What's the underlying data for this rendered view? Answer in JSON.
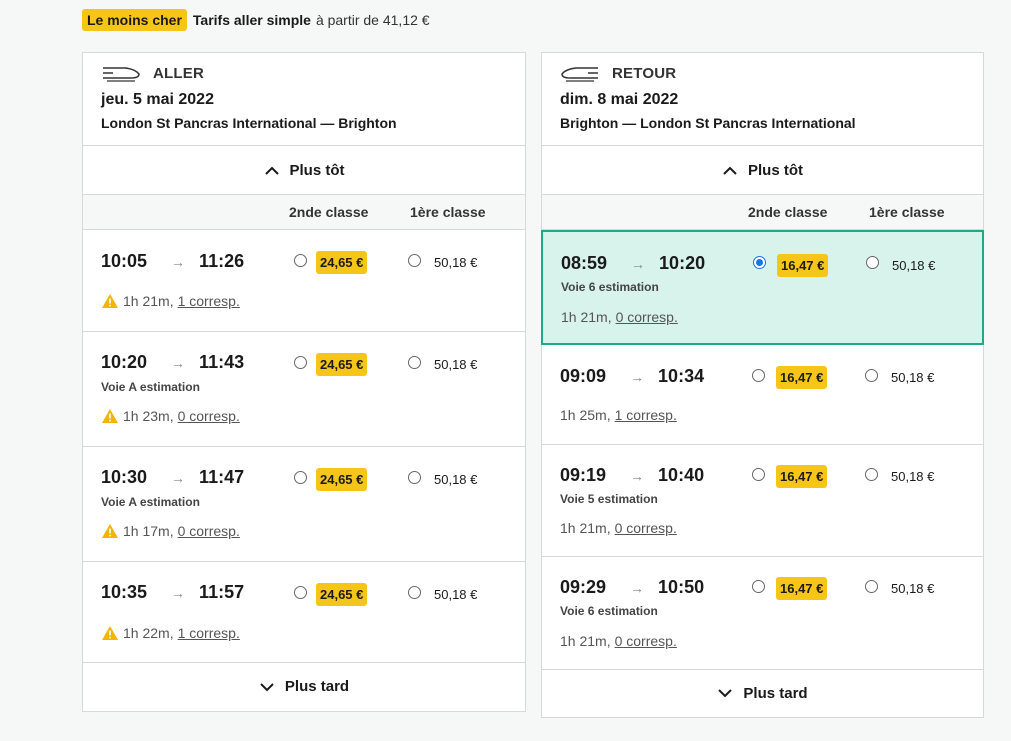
{
  "top": {
    "badge": "Le moins cher",
    "title": "Tarifs aller simple",
    "subtitle": "à partir de 41,12 €"
  },
  "aller": {
    "direction": "ALLER",
    "date": "jeu. 5 mai 2022",
    "route": "London St Pancras International — Brighton",
    "earlier": "Plus tôt",
    "later": "Plus tard",
    "class2": "2nde classe",
    "class1": "1ère classe",
    "rows": [
      {
        "dep": "10:05",
        "arr": "11:26",
        "voie": "",
        "duration": "1h 21m,",
        "corresp": "1 corresp.",
        "price2": "24,65 €",
        "price1": "50,18 €"
      },
      {
        "dep": "10:20",
        "arr": "11:43",
        "voie": "Voie A estimation",
        "duration": "1h 23m,",
        "corresp": "0 corresp.",
        "price2": "24,65 €",
        "price1": "50,18 €"
      },
      {
        "dep": "10:30",
        "arr": "11:47",
        "voie": "Voie A estimation",
        "duration": "1h 17m,",
        "corresp": "0 corresp.",
        "price2": "24,65 €",
        "price1": "50,18 €"
      },
      {
        "dep": "10:35",
        "arr": "11:57",
        "voie": "",
        "duration": "1h 22m,",
        "corresp": "1 corresp.",
        "price2": "24,65 €",
        "price1": "50,18 €"
      }
    ]
  },
  "retour": {
    "direction": "RETOUR",
    "date": "dim. 8 mai 2022",
    "route": "Brighton — London St Pancras International",
    "earlier": "Plus tôt",
    "later": "Plus tard",
    "class2": "2nde classe",
    "class1": "1ère classe",
    "rows": [
      {
        "dep": "08:59",
        "arr": "10:20",
        "voie": "Voie 6 estimation",
        "duration": "1h 21m,",
        "corresp": "0 corresp.",
        "price2": "16,47 €",
        "price1": "50,18 €"
      },
      {
        "dep": "09:09",
        "arr": "10:34",
        "voie": "",
        "duration": "1h 25m,",
        "corresp": "1 corresp.",
        "price2": "16,47 €",
        "price1": "50,18 €"
      },
      {
        "dep": "09:19",
        "arr": "10:40",
        "voie": "Voie 5 estimation",
        "duration": "1h 21m,",
        "corresp": "0 corresp.",
        "price2": "16,47 €",
        "price1": "50,18 €"
      },
      {
        "dep": "09:29",
        "arr": "10:50",
        "voie": "Voie 6 estimation",
        "duration": "1h 21m,",
        "corresp": "0 corresp.",
        "price2": "16,47 €",
        "price1": "50,18 €"
      }
    ]
  },
  "colors": {
    "accent_yellow": "#f5c518",
    "selected_bg": "#d8f2ec",
    "selected_border": "#21a88a",
    "radio_blue": "#1a73e8"
  },
  "icons": [
    "train-icon",
    "chevron-up-icon",
    "chevron-down-icon",
    "warning-icon",
    "arrow-right-icon"
  ]
}
